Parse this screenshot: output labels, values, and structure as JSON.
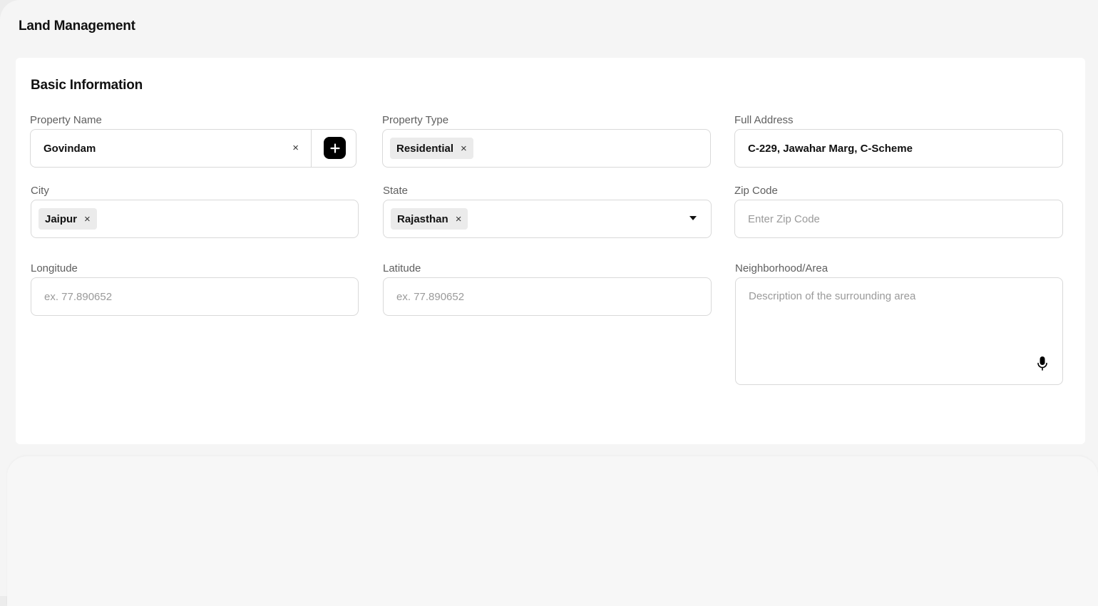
{
  "page": {
    "title": "Land Management"
  },
  "section": {
    "title": "Basic Information"
  },
  "fields": {
    "property_name": {
      "label": "Property Name",
      "value": "Govindam",
      "clear": "×"
    },
    "property_type": {
      "label": "Property Type",
      "chip": "Residential",
      "chip_remove": "×"
    },
    "full_address": {
      "label": "Full Address",
      "value": "C-229, Jawahar Marg, C-Scheme"
    },
    "city": {
      "label": "City",
      "chip": "Jaipur",
      "chip_remove": "×"
    },
    "state": {
      "label": "State",
      "chip": "Rajasthan",
      "chip_remove": "×"
    },
    "zip_code": {
      "label": "Zip Code",
      "placeholder": "Enter Zip Code"
    },
    "longitude": {
      "label": "Longitude",
      "placeholder": "ex. 77.890652"
    },
    "latitude": {
      "label": "Latitude",
      "placeholder": "ex. 77.890652"
    },
    "neighborhood": {
      "label": "Neighborhood/Area",
      "placeholder": "Description of the surrounding area"
    }
  },
  "icons": {
    "add": "plus-icon",
    "dropdown": "chevron-down-icon",
    "voice": "microphone-icon"
  }
}
